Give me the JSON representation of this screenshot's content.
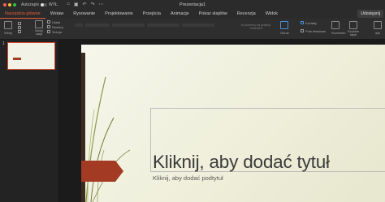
{
  "window": {
    "title": "Prezentacja1",
    "autosave_label": "Autozapis",
    "autosave_state": "WYŁ."
  },
  "ribbon_tabs": [
    "Narzędzia główne",
    "Wstaw",
    "Rysowanie",
    "Projektowanie",
    "Przejścia",
    "Animacje",
    "Pokaz slajdów",
    "Recenzja",
    "Widok"
  ],
  "share_label": "Udostępnij",
  "toolbar": {
    "paste_label": "Wklej",
    "new_slide_label": "Nowy slajd",
    "layout_label": "Układ",
    "reset_label": "Resetuj",
    "section_label": "Sekcja",
    "convert_smartart_label": "Konwertuj na grafikę SmartArt",
    "picture_label": "Obraz",
    "shapes_label": "Kształty",
    "textbox_label": "Pole tekstowe",
    "arrange_label": "Rozmieść",
    "quick_styles_label": "Szybkie style",
    "more_label": "dyk"
  },
  "thumbnails": {
    "items": [
      {
        "number": "1"
      }
    ]
  },
  "slide": {
    "title_placeholder": "Kliknij, aby dodać tytuł",
    "subtitle_placeholder": "Kliknij, aby dodać podtytuł"
  },
  "colors": {
    "accent": "#e35a3a",
    "arrow": "#a33a24",
    "ribbon_bg": "#2e2e2e"
  }
}
